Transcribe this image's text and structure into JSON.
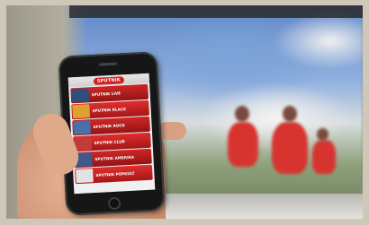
{
  "app": {
    "logo_text": "SPUTNIK"
  },
  "stations": [
    {
      "label": "SPUTNIK LIVE",
      "thumb_color": "#2f4f7a"
    },
    {
      "label": "SPUTNIK BLACK",
      "thumb_color": "#e0a030"
    },
    {
      "label": "SPUTNIK ROCK",
      "thumb_color": "#4d6fa8"
    },
    {
      "label": "SPUTNIK CLUB",
      "thumb_color": "#c23b3b"
    },
    {
      "label": "SPUTNIK AMERIKA",
      "thumb_color": "#3b5b8a"
    },
    {
      "label": "SPUTNIK POPKULT",
      "thumb_color": "#e2e2e2"
    }
  ],
  "colors": {
    "accent": "#d32020",
    "list_item": "#c01e1e"
  }
}
